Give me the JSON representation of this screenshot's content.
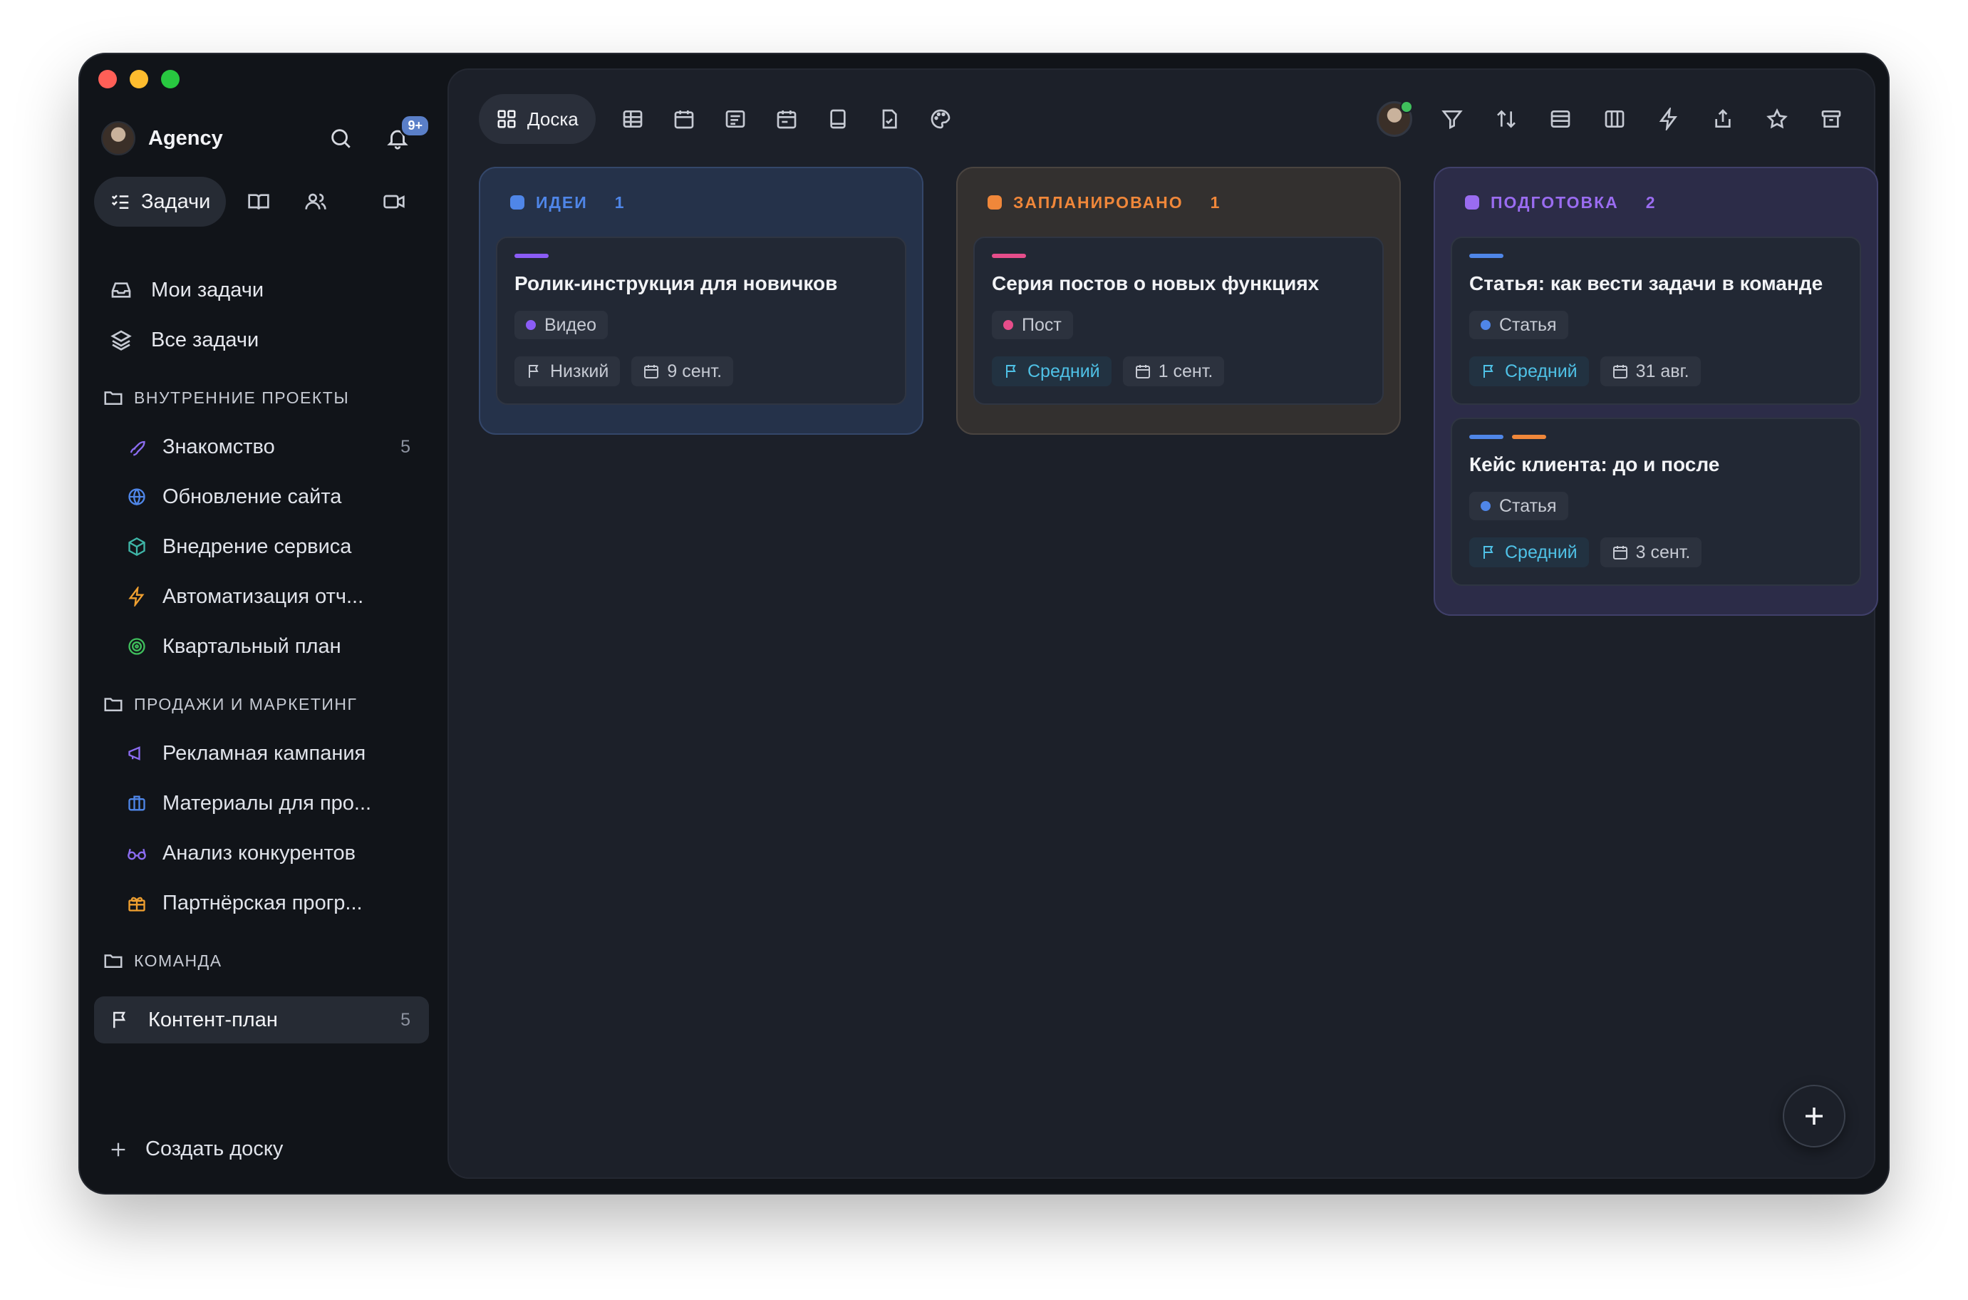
{
  "workspace": {
    "name": "Agency",
    "notifications_badge": "9+"
  },
  "modes": {
    "active_label": "Задачи"
  },
  "nav": {
    "my_tasks": "Мои задачи",
    "all_tasks": "Все задачи"
  },
  "groups": [
    {
      "title": "ВНУТРЕННИЕ ПРОЕКТЫ",
      "items": [
        {
          "label": "Знакомство",
          "count": "5",
          "icon": "rocket-icon",
          "color": "#8b6cf0"
        },
        {
          "label": "Обновление сайта",
          "count": "",
          "icon": "globe-icon",
          "color": "#4f86e8"
        },
        {
          "label": "Внедрение сервиса",
          "count": "",
          "icon": "cube-icon",
          "color": "#3fb6a8"
        },
        {
          "label": "Автоматизация отч...",
          "count": "",
          "icon": "lightning-icon",
          "color": "#f0a030"
        },
        {
          "label": "Квартальный план",
          "count": "",
          "icon": "target-icon",
          "color": "#3fbf5c"
        }
      ]
    },
    {
      "title": "ПРОДАЖИ И МАРКЕТИНГ",
      "items": [
        {
          "label": "Рекламная кампания",
          "count": "",
          "icon": "megaphone-icon",
          "color": "#8b6cf0"
        },
        {
          "label": "Материалы для про...",
          "count": "",
          "icon": "briefcase-icon",
          "color": "#4f86e8"
        },
        {
          "label": "Анализ конкурентов",
          "count": "",
          "icon": "glasses-icon",
          "color": "#8b6cf0"
        },
        {
          "label": "Партнёрская прогр...",
          "count": "",
          "icon": "gift-icon",
          "color": "#f0a030"
        }
      ]
    },
    {
      "title": "КОМАНДА",
      "items": []
    }
  ],
  "active_board": {
    "label": "Контент-план",
    "count": "5"
  },
  "create_board": "Создать доску",
  "views": {
    "active_label": "Доска"
  },
  "columns": [
    {
      "title": "ИДЕИ",
      "count": "1",
      "color": "#4f86e8",
      "bg": "#25324a",
      "border": "#34476a",
      "cards": [
        {
          "bars": [
            "#8b5cf6"
          ],
          "title": "Ролик-инструкция для новичков",
          "tag": {
            "label": "Видео",
            "color": "#8b5cf6"
          },
          "priority": "Низкий",
          "priority_level": "low",
          "date": "9 сент."
        }
      ]
    },
    {
      "title": "ЗАПЛАНИРОВАНО",
      "count": "1",
      "color": "#f0873a",
      "bg": "#33302f",
      "border": "#4a4440",
      "cards": [
        {
          "bars": [
            "#e64d8a"
          ],
          "title": "Серия постов о новых функциях",
          "tag": {
            "label": "Пост",
            "color": "#e64d8a"
          },
          "priority": "Средний",
          "priority_level": "medium",
          "date": "1 сент."
        }
      ]
    },
    {
      "title": "ПОДГОТОВКА",
      "count": "2",
      "color": "#9a6cf0",
      "bg": "#2c2c48",
      "border": "#40406a",
      "cards": [
        {
          "bars": [
            "#4f86e8"
          ],
          "title": "Статья: как вести задачи в команде",
          "tag": {
            "label": "Статья",
            "color": "#4f86e8"
          },
          "priority": "Средний",
          "priority_level": "medium",
          "date": "31 авг."
        },
        {
          "bars": [
            "#4f86e8",
            "#f0873a"
          ],
          "title": "Кейс клиента: до и после",
          "tag": {
            "label": "Статья",
            "color": "#4f86e8"
          },
          "priority": "Средний",
          "priority_level": "medium",
          "date": "3 сент."
        }
      ]
    }
  ]
}
